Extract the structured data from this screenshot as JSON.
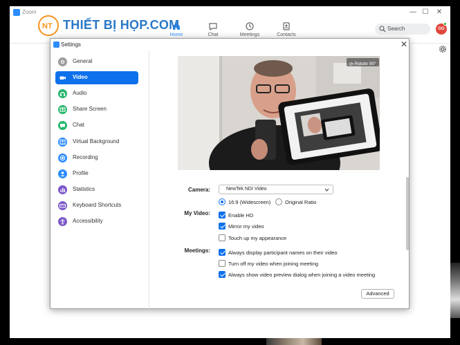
{
  "window": {
    "title": "Zoom",
    "minimize": "—",
    "maximize": "☐",
    "close": "✕"
  },
  "brand": {
    "badge": "NT",
    "name": "THIẾT BỊ HỌP.COM"
  },
  "nav": {
    "tabs": [
      {
        "label": "Home",
        "icon": "home-icon",
        "active": true
      },
      {
        "label": "Chat",
        "icon": "chat-icon",
        "active": false
      },
      {
        "label": "Meetings",
        "icon": "clock-icon",
        "active": false
      },
      {
        "label": "Contacts",
        "icon": "contacts-icon",
        "active": false
      }
    ],
    "search_placeholder": "Search",
    "avatar_initials": "GG"
  },
  "settings": {
    "title": "Settings",
    "close": "✕",
    "sidebar": [
      {
        "label": "General",
        "icon": "gear-icon",
        "color": "#9e9e9e",
        "active": false
      },
      {
        "label": "Video",
        "icon": "video-camera-icon",
        "color": "#0e71eb",
        "active": true
      },
      {
        "label": "Audio",
        "icon": "headphones-icon",
        "color": "#27b76e",
        "active": false
      },
      {
        "label": "Share Screen",
        "icon": "share-screen-icon",
        "color": "#27b76e",
        "active": false
      },
      {
        "label": "Chat",
        "icon": "chat-bubble-icon",
        "color": "#27b76e",
        "active": false
      },
      {
        "label": "Virtual Background",
        "icon": "person-background-icon",
        "color": "#2d8cff",
        "active": false
      },
      {
        "label": "Recording",
        "icon": "record-icon",
        "color": "#2d8cff",
        "active": false
      },
      {
        "label": "Profile",
        "icon": "profile-icon",
        "color": "#2d8cff",
        "active": false
      },
      {
        "label": "Statistics",
        "icon": "statistics-icon",
        "color": "#7d59c9",
        "active": false
      },
      {
        "label": "Keyboard Shortcuts",
        "icon": "keyboard-icon",
        "color": "#7d59c9",
        "active": false
      },
      {
        "label": "Accessibility",
        "icon": "accessibility-icon",
        "color": "#7d59c9",
        "active": false
      }
    ],
    "rotate_label": "Rotate 90°",
    "camera": {
      "label": "Camera:",
      "value": "NewTek NDI Video"
    },
    "aspect": {
      "widescreen": "16:9 (Widescreen)",
      "original": "Original Ratio",
      "selected": "widescreen"
    },
    "my_video": {
      "label": "My Video:",
      "options": [
        {
          "label": "Enable HD",
          "checked": true
        },
        {
          "label": "Mirror my video",
          "checked": true
        },
        {
          "label": "Touch up my appearance",
          "checked": false
        }
      ]
    },
    "meetings": {
      "label": "Meetings:",
      "options": [
        {
          "label": "Always display participant names on their video",
          "checked": true
        },
        {
          "label": "Turn off my video when joining meeting",
          "checked": false
        },
        {
          "label": "Always show video preview dialog when joining a video meeting",
          "checked": true
        }
      ]
    },
    "advanced_label": "Advanced"
  }
}
